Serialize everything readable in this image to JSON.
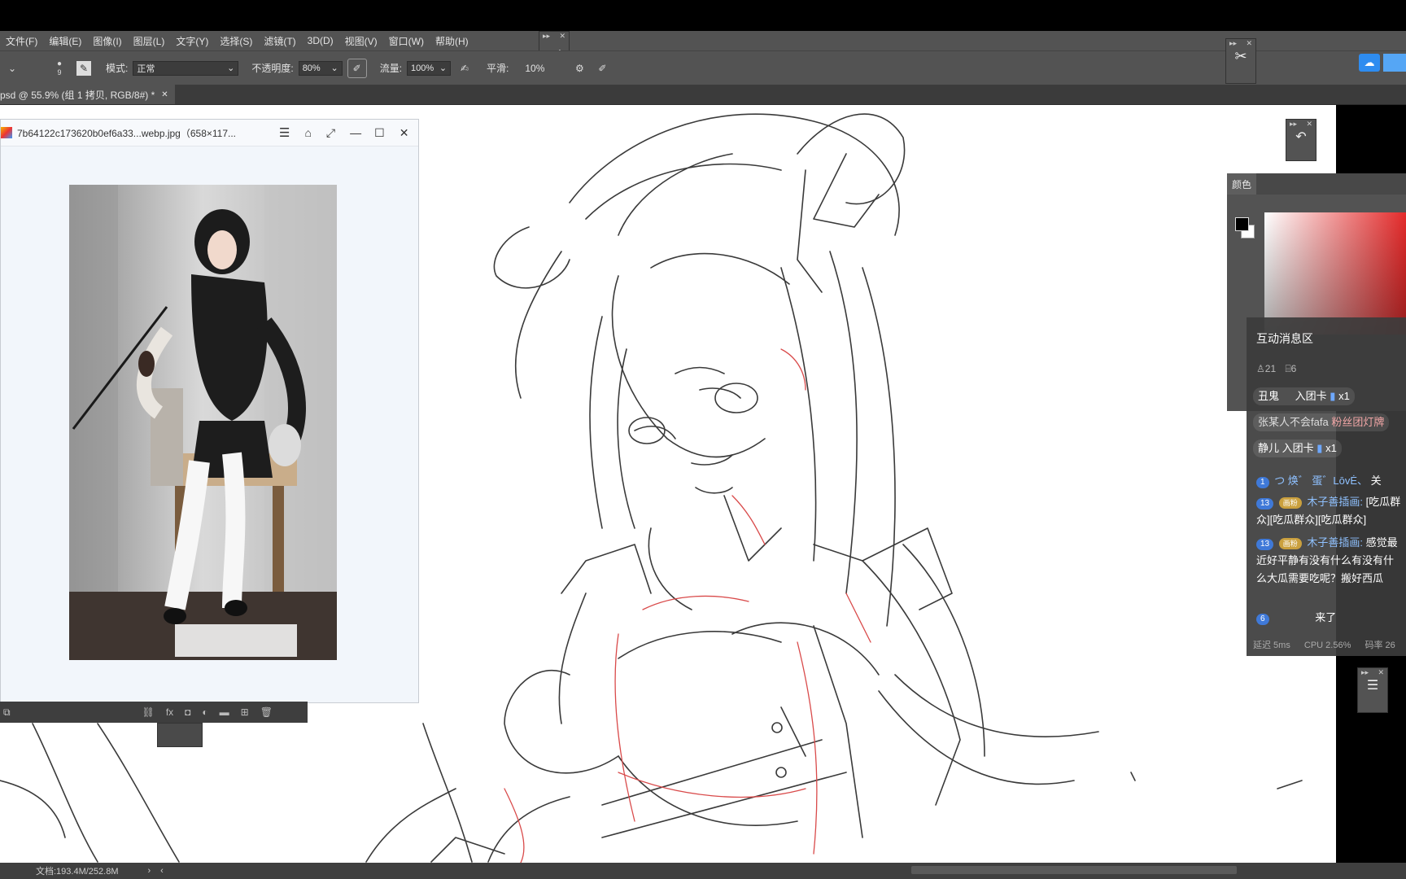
{
  "menubar": {
    "items": [
      "文件(F)",
      "编辑(E)",
      "图像(I)",
      "图层(L)",
      "文字(Y)",
      "选择(S)",
      "滤镜(T)",
      "3D(D)",
      "视图(V)",
      "窗口(W)",
      "帮助(H)"
    ]
  },
  "options": {
    "mode_label": "模式:",
    "mode_value": "正常",
    "opacity_label": "不透明度:",
    "opacity_value": "80%",
    "flow_label": "流量:",
    "flow_value": "100%",
    "smooth_label": "平滑:",
    "smooth_value": "10%",
    "brush_size": "9"
  },
  "document": {
    "tab_title": "psd @ 55.9% (组 1 拷贝, RGB/8#) *",
    "status_text": "文档:193.4M/252.8M"
  },
  "viewer": {
    "title": "7b64122c173620b0ef6a33...webp.jpg（658×117..."
  },
  "color_panel": {
    "tab_label": "颜色",
    "foreground": "#000000",
    "background": "#ffffff"
  },
  "chat": {
    "title": "互动消息区",
    "viewers": "21",
    "gifts": "6",
    "messages": [
      {
        "user": "丑鬼",
        "action": "入团卡",
        "count": "x1"
      },
      {
        "user": "张某人不会fafa",
        "action": "粉丝团灯牌"
      },
      {
        "user": "静儿",
        "action": "入团卡",
        "count": "x1"
      },
      {
        "level": "1",
        "user": "つ 焕゛ 蛋゛LōvĖ、",
        "text": "关"
      },
      {
        "level": "13",
        "medal": "画粉",
        "user": "木子善插画:",
        "text": "[吃瓜群众][吃瓜群众][吃瓜群众]"
      },
      {
        "level": "13",
        "medal": "画粉",
        "user": "木子善插画:",
        "text": "感觉最近好平静有没有什么有没有什么大瓜需要吃呢？搬好西瓜"
      },
      {
        "level": "6",
        "user": "",
        "text": "来了"
      }
    ],
    "footer": {
      "latency": "延迟 5ms",
      "cpu": "CPU 2.56%",
      "bitrate": "码率 26"
    }
  },
  "colors": {
    "chrome": "#535353",
    "menubar_text": "#e4e4e4",
    "canvas": "#ffffff",
    "sketch_stroke": "#3a3a3a",
    "sketch_red": "#d94a4a",
    "accent_blue": "#2e8cf0"
  }
}
